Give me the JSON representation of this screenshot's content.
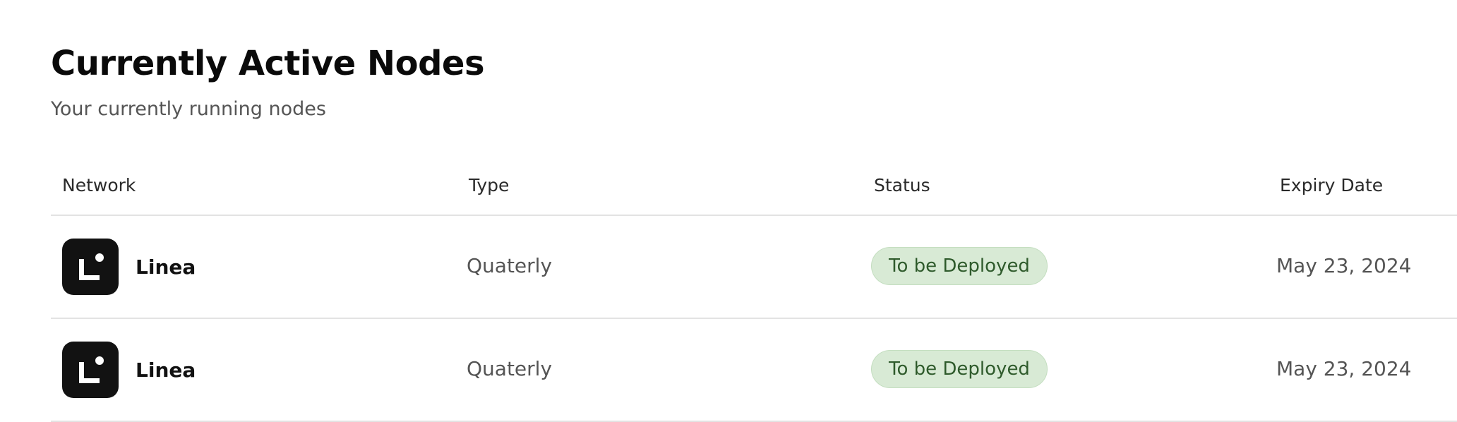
{
  "header": {
    "title": "Currently Active Nodes",
    "subtitle": "Your currently running nodes"
  },
  "table": {
    "columns": [
      "Network",
      "Type",
      "Status",
      "Expiry Date"
    ],
    "rows": [
      {
        "network": "Linea",
        "network_icon": "linea-logo-icon",
        "type": "Quaterly",
        "status": "To be Deployed",
        "expiry": "May 23, 2024"
      },
      {
        "network": "Linea",
        "network_icon": "linea-logo-icon",
        "type": "Quaterly",
        "status": "To be Deployed",
        "expiry": "May 23, 2024"
      }
    ]
  },
  "colors": {
    "status_badge_bg": "#d8ead5",
    "status_badge_text": "#2f5b2c",
    "logo_bg": "#121212"
  }
}
